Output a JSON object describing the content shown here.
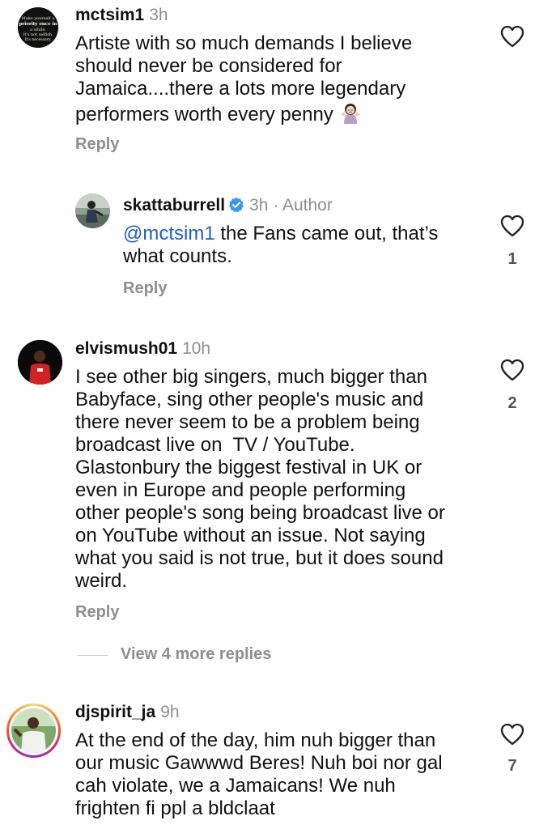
{
  "comments": [
    {
      "username": "mctsim1",
      "time": "3h",
      "avatar_text": "Make yourself a priority once in a while. It's not selfish. It's necessary.",
      "lines": [
        "Artiste with so much demands I believe",
        "should never be considered for",
        "Jamaica....there a lots more legendary",
        "performers worth every penny"
      ],
      "reply_label": "Reply",
      "likes": ""
    },
    {
      "username": "skattaburrell",
      "time": "3h",
      "author_label": "· Author",
      "mention": "@mctsim1",
      "lines": [
        " the Fans came out, that’s",
        "what counts."
      ],
      "reply_label": "Reply",
      "likes": "1"
    },
    {
      "username": "elvismush01",
      "time": "10h",
      "lines": [
        "I see other big singers, much bigger than",
        "Babyface, sing other people's music and",
        "there never seem to be a problem being",
        "broadcast live on  TV / YouTube.",
        "Glastonbury the biggest festival in UK or",
        "even in Europe and people performing",
        "other people's song being broadcast live or",
        "on YouTube without an issue. Not saying",
        "what you said is not true, but it does sound",
        "weird."
      ],
      "reply_label": "Reply",
      "likes": "2"
    },
    {
      "username": "djspirit_ja",
      "time": "9h",
      "lines": [
        "At the end of the day, him nuh bigger than",
        "our music Gawwwd Beres! Nuh boi nor gal",
        "cah violate, we a Jamaicans! We nuh",
        "frighten fi ppl a bldclaat"
      ],
      "likes": "7"
    }
  ],
  "view_more_label": "View 4 more replies",
  "icons": {
    "heart": "heart-outline-icon",
    "verified": "verified-badge-icon",
    "emoji": "woman-shrugging-emoji"
  },
  "colors": {
    "username": "#111111",
    "secondary": "#8e8e8e",
    "mention": "#1e5ecf",
    "verified": "#3897f0",
    "story_ring": "#d6249f"
  }
}
